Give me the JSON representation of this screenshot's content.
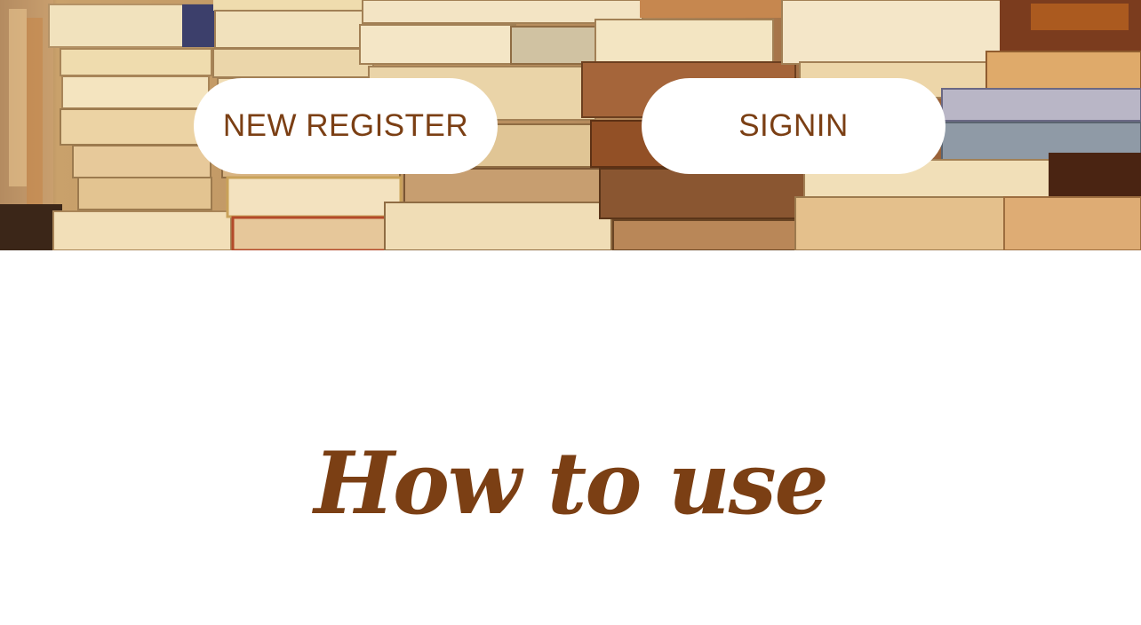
{
  "hero": {
    "image": "stacked-books-photo"
  },
  "nav": {
    "register_label": "NEW REGISTER",
    "signin_label": "SIGNIN"
  },
  "main": {
    "heading": "How to use"
  },
  "colors": {
    "accent": "#7b3f14",
    "button_bg": "#ffffff",
    "page_bg": "#ffffff"
  }
}
